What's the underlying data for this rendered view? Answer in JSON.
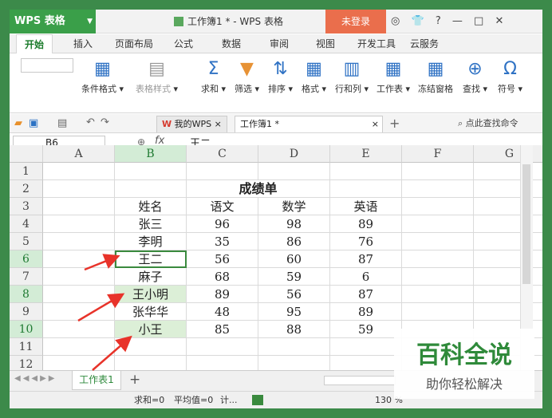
{
  "app": {
    "name": "WPS 表格",
    "doc_title": "工作簿1 * - WPS 表格",
    "login": "未登录",
    "ctl": {
      "a": "?",
      "min": "—",
      "max": "□",
      "close": "✕"
    }
  },
  "ribbon_tabs": [
    "开始",
    "插入",
    "页面布局",
    "公式",
    "数据",
    "审阅",
    "视图",
    "开发工具",
    "云服务"
  ],
  "ribbon": {
    "cond_fmt": "条件格式",
    "table_style": "表格样式",
    "sum": "求和",
    "filter": "筛选",
    "sort": "排序",
    "format": "格式",
    "rowcol": "行和列",
    "sheet": "工作表",
    "freeze": "冻结窗格",
    "find": "查找",
    "symbol": "符号"
  },
  "doc_tabs": {
    "mywps": "我的WPS",
    "workbook": "工作簿1 *",
    "search": "点此查找命令"
  },
  "formula": {
    "cell_ref": "B6",
    "fx": "fx",
    "value": "王二"
  },
  "columns": [
    "A",
    "B",
    "C",
    "D",
    "E",
    "F",
    "G"
  ],
  "rows": [
    "1",
    "2",
    "3",
    "4",
    "5",
    "6",
    "7",
    "8",
    "9",
    "10",
    "11",
    "12"
  ],
  "table": {
    "title": "成绩单",
    "header": [
      "姓名",
      "语文",
      "数学",
      "英语"
    ],
    "data": [
      [
        "张三",
        "96",
        "98",
        "89"
      ],
      [
        "李明",
        "35",
        "86",
        "76"
      ],
      [
        "王二",
        "56",
        "60",
        "87"
      ],
      [
        "麻子",
        "68",
        "59",
        "6"
      ],
      [
        "王小明",
        "89",
        "56",
        "87"
      ],
      [
        "张华华",
        "48",
        "95",
        "89"
      ],
      [
        "小王",
        "85",
        "88",
        "59"
      ]
    ]
  },
  "sheet_tab": "工作表1",
  "status": {
    "sum": "求和=0",
    "avg": "平均值=0",
    "count": "计...",
    "zoom": "130 %"
  },
  "watermark": {
    "line1": "百科全说",
    "line2": "助你轻松解决"
  },
  "colors": {
    "accent": "#3a9f49",
    "login": "#ea6e4c",
    "highlight": "#dcefd7",
    "arrow": "#e8332a"
  }
}
